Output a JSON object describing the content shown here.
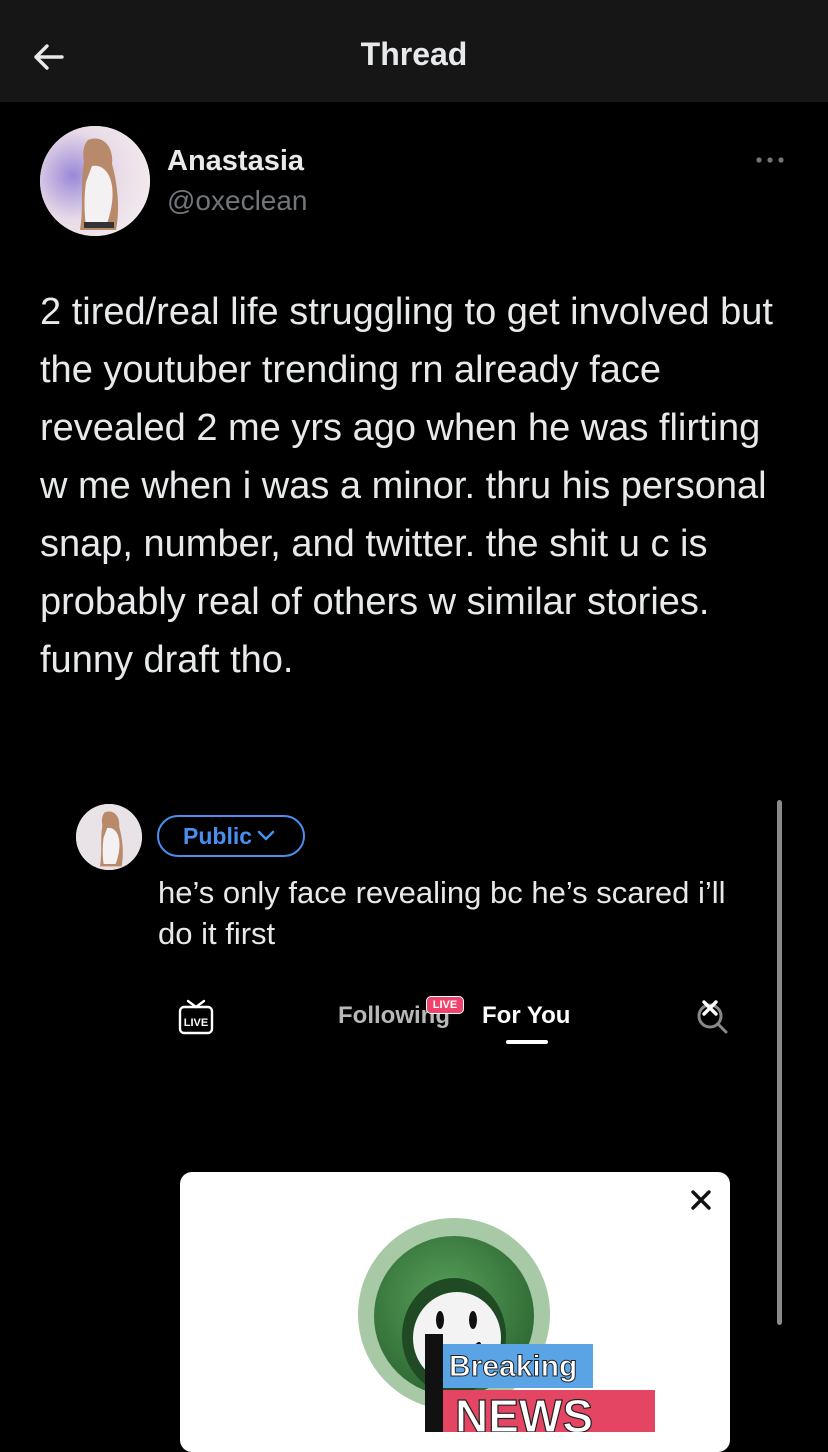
{
  "header": {
    "title": "Thread",
    "back_icon": "arrow-left-icon"
  },
  "tweet": {
    "author_name": "Anastasia",
    "author_handle": "@oxeclean",
    "more_icon": "ellipsis-icon",
    "text": "2 tired/real life struggling to get involved but the youtuber trending rn already face revealed 2 me yrs ago when he was flirting w me when i was a minor. thru his personal snap, number, and twitter. the shit u c is probably real of others w similar stories. funny draft tho."
  },
  "embedded_screenshot": {
    "privacy_label": "Public",
    "caption": "he’s only face revealing bc he’s scared i’ll do it first",
    "live_icon_label": "LIVE",
    "tabs": [
      {
        "label": "Following",
        "badge": "LIVE"
      },
      {
        "label": "For You",
        "active": true
      }
    ],
    "card": {
      "headline_top": "Breaking",
      "headline_bottom": "NEWS"
    }
  },
  "colors": {
    "background": "#000000",
    "topbar": "#161616",
    "text": "#e7e9ea",
    "secondary_text": "#71767b",
    "accent_blue": "#4a8ff0",
    "live_pink": "#f0426b"
  }
}
